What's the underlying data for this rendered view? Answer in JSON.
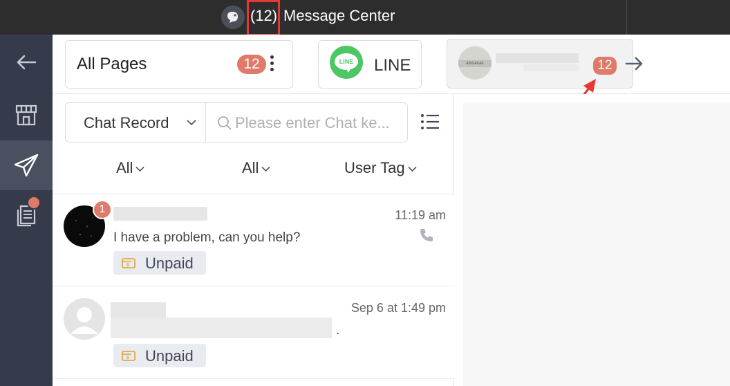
{
  "titlebar": {
    "count": "(12)",
    "title": "Message Center"
  },
  "sidebar": {
    "items": [
      {
        "name": "back-icon"
      },
      {
        "name": "store-icon"
      },
      {
        "name": "send-icon"
      },
      {
        "name": "document-icon"
      }
    ]
  },
  "pages": {
    "title": "All Pages",
    "badge": "12"
  },
  "line": {
    "logo_text": "LINE",
    "label": "LINE"
  },
  "account": {
    "avatar_text": "AINGAKAE",
    "badge": "12"
  },
  "search": {
    "select_label": "Chat Record",
    "placeholder": "Please enter Chat ke..."
  },
  "filters": [
    {
      "label": "All"
    },
    {
      "label": "All"
    },
    {
      "label": "User Tag"
    }
  ],
  "chats": [
    {
      "unread": "1",
      "time": "11:19 am",
      "message": "I have a problem, can you help?",
      "tag": "Unpaid"
    },
    {
      "time": "Sep 6 at 1:49 pm",
      "message": ".",
      "tag": "Unpaid"
    }
  ],
  "colors": {
    "badge": "#e07a6a",
    "sidebar": "#353b4a",
    "line_green": "#4cc764",
    "annotation_red": "#e53935"
  }
}
